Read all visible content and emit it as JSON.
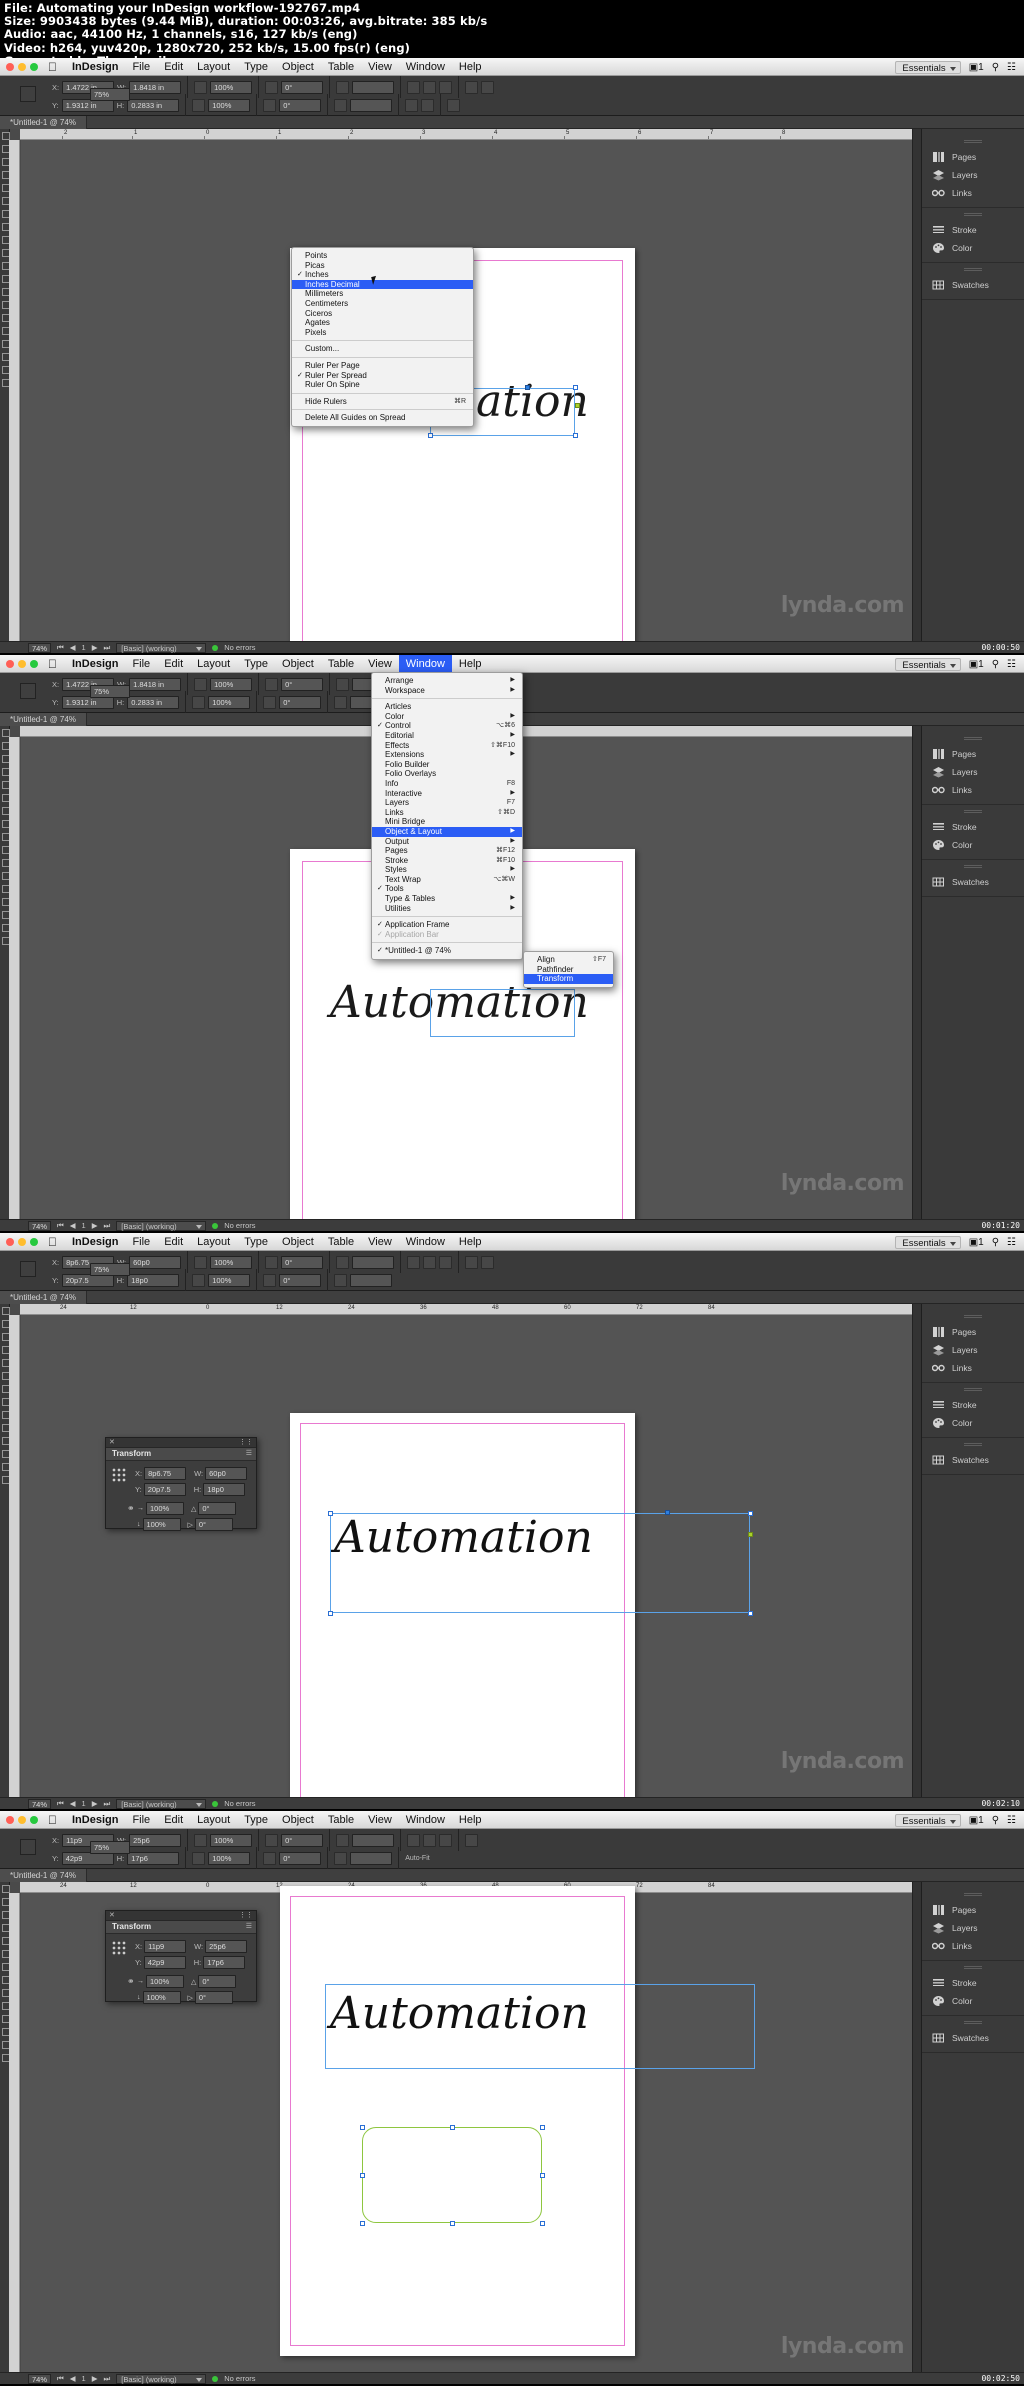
{
  "meta": {
    "file_line": "File: Automating your InDesign workflow-192767.mp4",
    "size_line": "Size: 9903438 bytes (9.44 MiB), duration: 00:03:26, avg.bitrate: 385 kb/s",
    "audio_line": "Audio: aac, 44100 Hz, 1 channels, s16, 127 kb/s (eng)",
    "video_line": "Video: h264, yuv420p, 1280x720, 252 kb/s, 15.00 fps(r) (eng)",
    "generated_line": "Generated by Thumbnail me"
  },
  "app": {
    "name": "InDesign",
    "menus": [
      "InDesign",
      "File",
      "Edit",
      "Layout",
      "Type",
      "Object",
      "Table",
      "View",
      "Window",
      "Help"
    ],
    "workspace": "Essentials",
    "doc_tab": "*Untitled-1 @ 74%",
    "zoom_values": [
      "75%",
      "75%",
      "75%",
      "75%"
    ],
    "watermark": "lynda.com"
  },
  "dock": {
    "groups": [
      {
        "items": [
          {
            "label": "Pages",
            "icon": "pages-icon"
          },
          {
            "label": "Layers",
            "icon": "layers-icon"
          },
          {
            "label": "Links",
            "icon": "links-icon"
          }
        ]
      },
      {
        "items": [
          {
            "label": "Stroke",
            "icon": "stroke-icon"
          },
          {
            "label": "Color",
            "icon": "color-icon"
          }
        ]
      },
      {
        "items": [
          {
            "label": "Swatches",
            "icon": "swatches-icon"
          }
        ]
      }
    ]
  },
  "statusbar": {
    "zoom": "74%",
    "page": "1",
    "preset": "[Basic] (working)",
    "errors": "No errors"
  },
  "control_bar": {
    "x_label": "X:",
    "y_label": "Y:",
    "w_label": "W:",
    "h_label": "H:",
    "scale_x": "100%",
    "scale_y": "100%",
    "rotate": "0°",
    "shear": "0°",
    "fit_label": "Auto-Fit"
  },
  "panels": [
    {
      "id": "panel-1",
      "timestamp": "00:00:50",
      "zoom": "75%",
      "control_x": "1.4722 in",
      "control_y": "1.9312 in",
      "control_w": "1.8418 in",
      "control_h": "0.2833 in",
      "artwork_text": "Automation",
      "context_menu": {
        "name": "ruler-units-menu",
        "items": [
          {
            "label": "Points",
            "checked": false,
            "highlighted": false,
            "shortcut": "",
            "submenu": false
          },
          {
            "label": "Picas",
            "checked": false,
            "highlighted": false,
            "shortcut": "",
            "submenu": false
          },
          {
            "label": "Inches",
            "checked": true,
            "highlighted": false,
            "shortcut": "",
            "submenu": false
          },
          {
            "label": "Inches Decimal",
            "checked": false,
            "highlighted": true,
            "shortcut": "",
            "submenu": false
          },
          {
            "label": "Millimeters",
            "checked": false,
            "highlighted": false,
            "shortcut": "",
            "submenu": false
          },
          {
            "label": "Centimeters",
            "checked": false,
            "highlighted": false,
            "shortcut": "",
            "submenu": false
          },
          {
            "label": "Ciceros",
            "checked": false,
            "highlighted": false,
            "shortcut": "",
            "submenu": false
          },
          {
            "label": "Agates",
            "checked": false,
            "highlighted": false,
            "shortcut": "",
            "submenu": false
          },
          {
            "label": "Pixels",
            "checked": false,
            "highlighted": false,
            "shortcut": "",
            "submenu": false
          },
          {
            "divider": true
          },
          {
            "label": "Custom...",
            "checked": false,
            "highlighted": false,
            "shortcut": "",
            "submenu": false
          },
          {
            "divider": true
          },
          {
            "label": "Ruler Per Page",
            "checked": false,
            "highlighted": false,
            "shortcut": "",
            "submenu": false
          },
          {
            "label": "Ruler Per Spread",
            "checked": true,
            "highlighted": false,
            "shortcut": "",
            "submenu": false
          },
          {
            "label": "Ruler On Spine",
            "checked": false,
            "highlighted": false,
            "shortcut": "",
            "submenu": false
          },
          {
            "divider": true
          },
          {
            "label": "Hide Rulers",
            "checked": false,
            "highlighted": false,
            "shortcut": "⌘R",
            "submenu": false
          },
          {
            "divider": true
          },
          {
            "label": "Delete All Guides on Spread",
            "checked": false,
            "highlighted": false,
            "shortcut": "",
            "submenu": false
          }
        ]
      }
    },
    {
      "id": "panel-2",
      "timestamp": "00:01:20",
      "zoom": "75%",
      "control_x": "1.4722 in",
      "control_y": "1.9312 in",
      "control_w": "1.8418 in",
      "control_h": "0.2833 in",
      "artwork_text": "Automation",
      "active_menu": "Window",
      "window_menu": {
        "name": "window-menu",
        "items": [
          {
            "label": "Arrange",
            "checked": false,
            "shortcut": "",
            "submenu": true
          },
          {
            "label": "Workspace",
            "checked": false,
            "shortcut": "",
            "submenu": true
          },
          {
            "divider": true
          },
          {
            "label": "Articles",
            "checked": false,
            "shortcut": "",
            "submenu": false
          },
          {
            "label": "Color",
            "checked": false,
            "shortcut": "",
            "submenu": true
          },
          {
            "label": "Control",
            "checked": true,
            "shortcut": "⌥⌘6",
            "submenu": false
          },
          {
            "label": "Editorial",
            "checked": false,
            "shortcut": "",
            "submenu": true
          },
          {
            "label": "Effects",
            "checked": false,
            "shortcut": "⇧⌘F10",
            "submenu": false
          },
          {
            "label": "Extensions",
            "checked": false,
            "shortcut": "",
            "submenu": true
          },
          {
            "label": "Folio Builder",
            "checked": false,
            "shortcut": "",
            "submenu": false
          },
          {
            "label": "Folio Overlays",
            "checked": false,
            "shortcut": "",
            "submenu": false
          },
          {
            "label": "Info",
            "checked": false,
            "shortcut": "F8",
            "submenu": false
          },
          {
            "label": "Interactive",
            "checked": false,
            "shortcut": "",
            "submenu": true
          },
          {
            "label": "Layers",
            "checked": false,
            "shortcut": "F7",
            "submenu": false
          },
          {
            "label": "Links",
            "checked": false,
            "shortcut": "⇧⌘D",
            "submenu": false
          },
          {
            "label": "Mini Bridge",
            "checked": false,
            "shortcut": "",
            "submenu": false
          },
          {
            "label": "Object & Layout",
            "checked": false,
            "shortcut": "",
            "submenu": true,
            "highlighted": true
          },
          {
            "label": "Output",
            "checked": false,
            "shortcut": "",
            "submenu": true
          },
          {
            "label": "Pages",
            "checked": false,
            "shortcut": "⌘F12",
            "submenu": false
          },
          {
            "label": "Stroke",
            "checked": false,
            "shortcut": "⌘F10",
            "submenu": false
          },
          {
            "label": "Styles",
            "checked": false,
            "shortcut": "",
            "submenu": true
          },
          {
            "label": "Text Wrap",
            "checked": false,
            "shortcut": "⌥⌘W",
            "submenu": false
          },
          {
            "label": "Tools",
            "checked": true,
            "shortcut": "",
            "submenu": false
          },
          {
            "label": "Type & Tables",
            "checked": false,
            "shortcut": "",
            "submenu": true
          },
          {
            "label": "Utilities",
            "checked": false,
            "shortcut": "",
            "submenu": true
          },
          {
            "divider": true
          },
          {
            "label": "Application Frame",
            "checked": true,
            "shortcut": "",
            "submenu": false
          },
          {
            "label": "Application Bar",
            "checked": true,
            "shortcut": "",
            "submenu": false,
            "dim": true
          },
          {
            "divider": true
          },
          {
            "label": "*Untitled-1 @ 74%",
            "checked": true,
            "shortcut": "",
            "submenu": false
          }
        ]
      },
      "submenu": {
        "name": "object-and-layout-submenu",
        "items": [
          {
            "label": "Align",
            "shortcut": "⇧F7",
            "highlighted": false
          },
          {
            "label": "Pathfinder",
            "shortcut": "",
            "highlighted": false
          },
          {
            "label": "Transform",
            "shortcut": "",
            "highlighted": true
          }
        ]
      }
    },
    {
      "id": "panel-3",
      "timestamp": "00:02:10",
      "zoom": "75%",
      "control_x": "8p6.75",
      "control_y": "20p7.5",
      "control_w": "60p0",
      "control_h": "18p0",
      "artwork_text": "Automation",
      "transform_panel": {
        "title": "Transform",
        "x_label": "X:",
        "y_label": "Y:",
        "w_label": "W:",
        "h_label": "H:",
        "x": "8p6.75",
        "y": "20p7.5",
        "w": "60p0",
        "h": "18p0",
        "scale_x": "100%",
        "scale_y": "100%",
        "rotate": "0°",
        "shear": "0°"
      }
    },
    {
      "id": "panel-4",
      "timestamp": "00:02:50",
      "zoom": "75%",
      "control_x": "11p9",
      "control_y": "42p9",
      "control_w": "25p6",
      "control_h": "17p6",
      "artwork_text": "Automation",
      "transform_panel": {
        "title": "Transform",
        "x_label": "X:",
        "y_label": "Y:",
        "w_label": "W:",
        "h_label": "H:",
        "x": "11p9",
        "y": "42p9",
        "w": "25p6",
        "h": "17p6",
        "scale_x": "100%",
        "scale_y": "100%",
        "rotate": "0°",
        "shear": "0°"
      }
    }
  ]
}
